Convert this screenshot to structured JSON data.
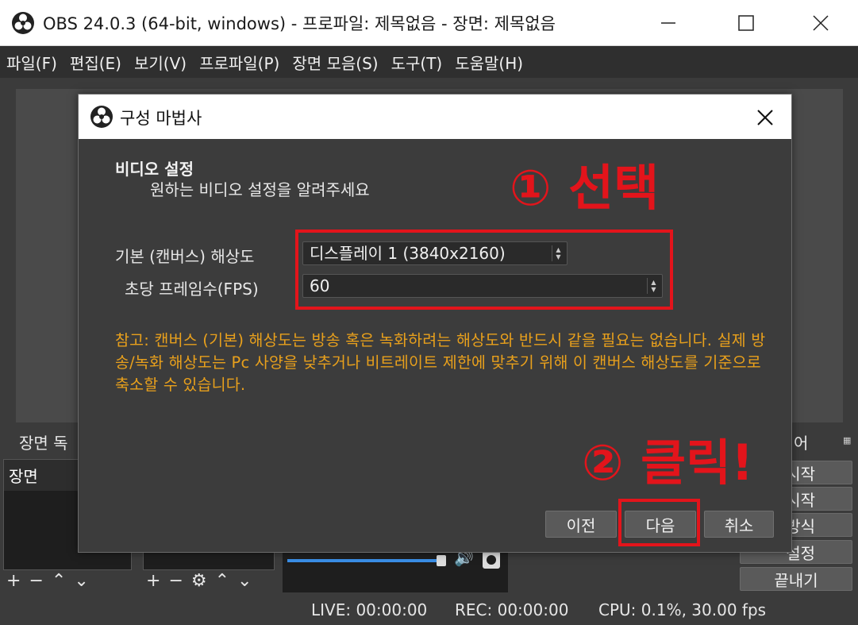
{
  "window": {
    "title": "OBS 24.0.3 (64-bit, windows) - 프로파일: 제목없음 - 장면: 제목없음"
  },
  "menu": {
    "items": [
      "파일(F)",
      "편집(E)",
      "보기(V)",
      "프로파일(P)",
      "장면 모음(S)",
      "도구(T)",
      "도움말(H)"
    ]
  },
  "docks": {
    "scenes_header": "장면 독",
    "right_header": "어",
    "scene_item": "장면"
  },
  "controls": {
    "btn1": "시작",
    "btn2": "시작",
    "btn3": "방식",
    "btn4": "설정",
    "btn5": "끝내기"
  },
  "status": {
    "live": "LIVE: 00:00:00",
    "rec": "REC: 00:00:00",
    "cpu": "CPU: 0.1%, 30.00 fps"
  },
  "dialog": {
    "title": "구성 마법사",
    "section_title": "비디오 설정",
    "section_subtitle": "원하는 비디오 설정을 알려주세요",
    "resolution_label": "기본 (캔버스) 해상도",
    "resolution_value": "디스플레이 1 (3840x2160)",
    "fps_label": "초당 프레임수(FPS)",
    "fps_value": "60",
    "note": "참고: 캔버스 (기본) 해상도는 방송 혹은 녹화하려는 해상도와 반드시 같을 필요는 없습니다. 실제 방송/녹화 해상도는 Pc 사양을 낮추거나 비트레이트 제한에 맞추기 위해 이 캔버스 해상도를 기준으로 축소할 수 있습니다.",
    "back_label": "이전",
    "next_label": "다음",
    "cancel_label": "취소"
  },
  "annotations": {
    "step1": "① 선택",
    "step2": "② 클릭!",
    "color": "#e3141b"
  }
}
